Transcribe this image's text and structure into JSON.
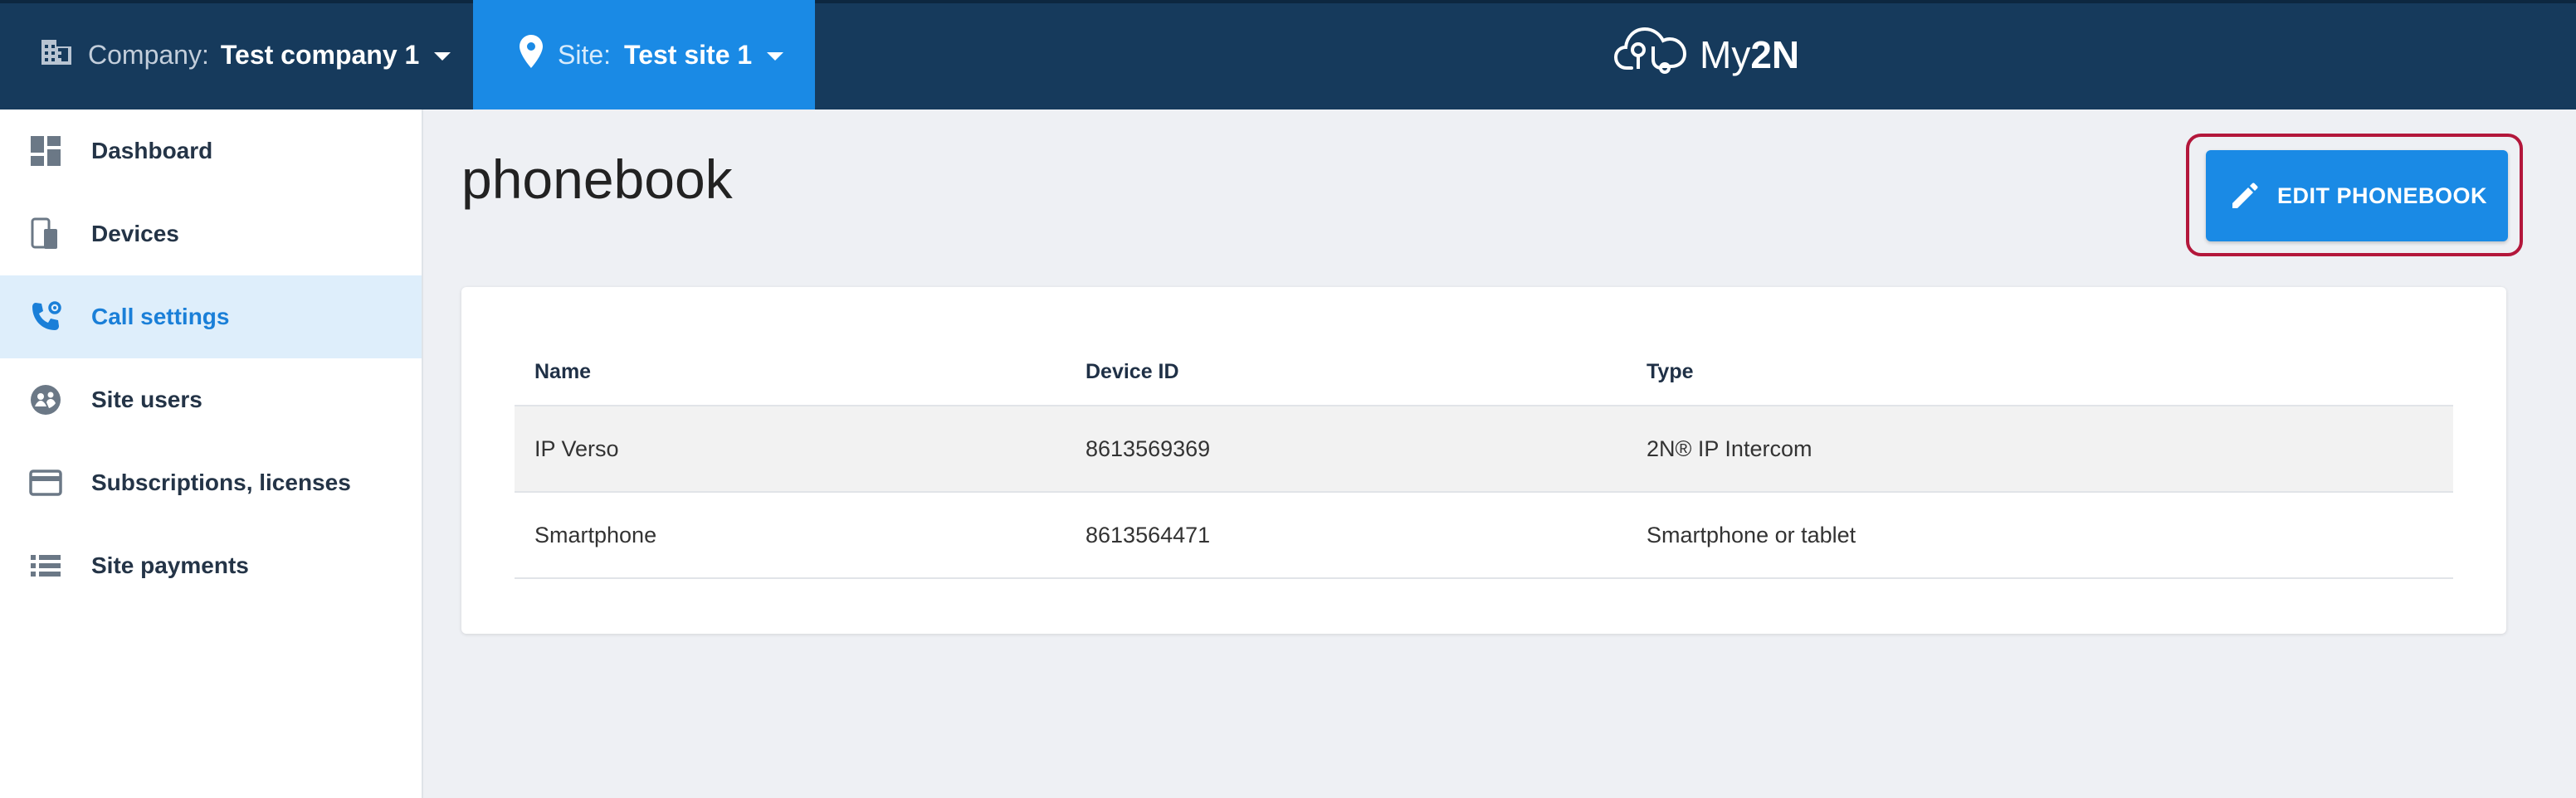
{
  "header": {
    "company_label": "Company:",
    "company_value": "Test company 1",
    "site_label": "Site:",
    "site_value": "Test site 1",
    "logo_my": "My",
    "logo_2n": "2N",
    "colors": {
      "bar": "#163a5c",
      "site": "#1a8ae5"
    }
  },
  "sidebar": {
    "items": [
      {
        "label": "Dashboard",
        "icon": "dashboard-icon"
      },
      {
        "label": "Devices",
        "icon": "devices-icon"
      },
      {
        "label": "Call settings",
        "icon": "phone-settings-icon",
        "active": true
      },
      {
        "label": "Site users",
        "icon": "users-icon"
      },
      {
        "label": "Subscriptions, licenses",
        "icon": "credit-card-icon"
      },
      {
        "label": "Site payments",
        "icon": "list-icon"
      }
    ]
  },
  "main": {
    "title": "phonebook",
    "edit_button": "EDIT PHONEBOOK",
    "table": {
      "headers": [
        "Name",
        "Device ID",
        "Type"
      ],
      "rows": [
        [
          "IP Verso",
          "8613569369",
          "2N® IP Intercom"
        ],
        [
          "Smartphone",
          "8613564471",
          "Smartphone or tablet"
        ]
      ]
    }
  }
}
